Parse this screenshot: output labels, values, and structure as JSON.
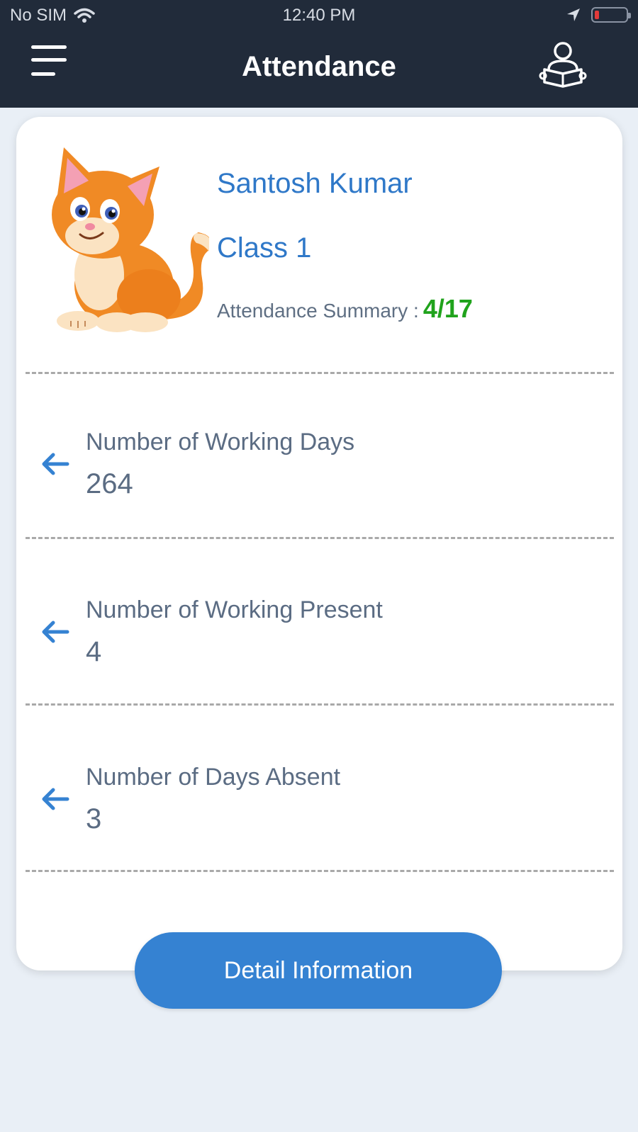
{
  "status_bar": {
    "carrier": "No SIM",
    "time": "12:40 PM",
    "battery_level_percent": 10
  },
  "header": {
    "title": "Attendance"
  },
  "student": {
    "name": "Santosh Kumar",
    "class": "Class 1",
    "summary_label": "Attendance Summary :",
    "summary_value": "4/17"
  },
  "stats": [
    {
      "label": "Number of Working Days",
      "value": "264"
    },
    {
      "label": "Number of Working Present",
      "value": "4"
    },
    {
      "label": "Number of Days Absent",
      "value": "3"
    }
  ],
  "actions": {
    "detail_label": "Detail Information"
  },
  "colors": {
    "header_bg": "#212b3a",
    "accent": "#2f78c8",
    "button": "#3582d2",
    "summary_green": "#20a31c",
    "page_bg": "#e9eff6"
  }
}
